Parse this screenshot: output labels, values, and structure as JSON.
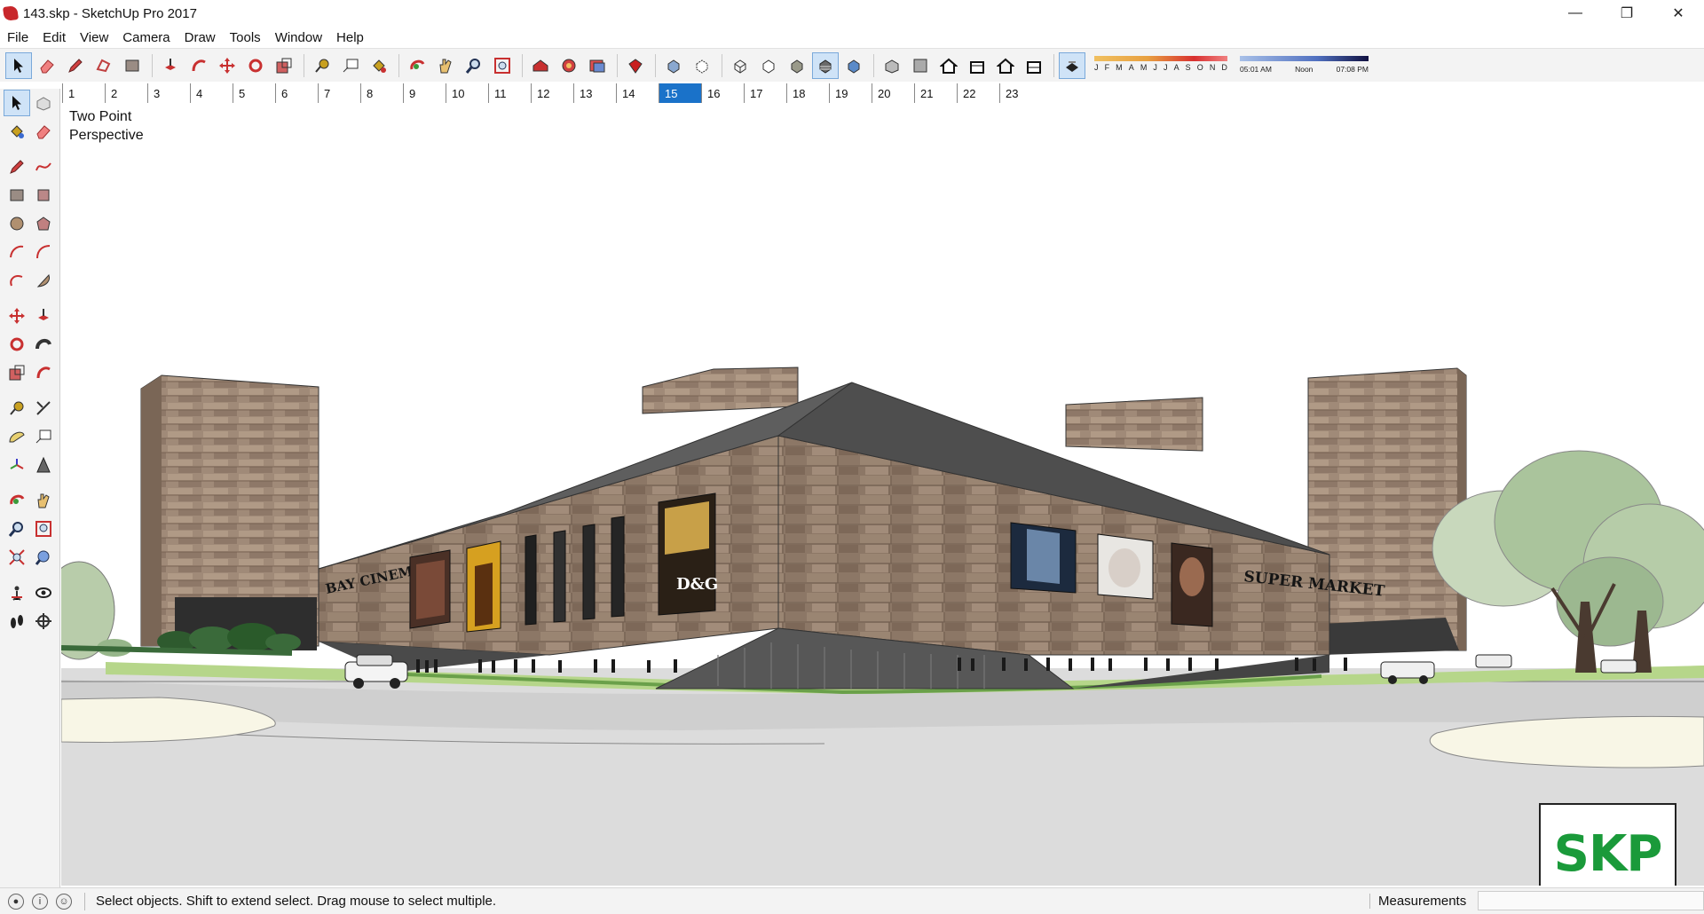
{
  "window": {
    "title": "143.skp - SketchUp Pro 2017",
    "minimize": "—",
    "maximize": "❐",
    "close": "✕"
  },
  "menu": [
    "File",
    "Edit",
    "View",
    "Camera",
    "Draw",
    "Tools",
    "Window",
    "Help"
  ],
  "scenes": {
    "tabs": [
      "1",
      "2",
      "3",
      "4",
      "5",
      "6",
      "7",
      "8",
      "9",
      "10",
      "11",
      "12",
      "13",
      "14",
      "15",
      "16",
      "17",
      "18",
      "19",
      "20",
      "21",
      "22",
      "23"
    ],
    "active": "15"
  },
  "shadow_settings": {
    "months": [
      "J",
      "F",
      "M",
      "A",
      "M",
      "J",
      "J",
      "A",
      "S",
      "O",
      "N",
      "D"
    ],
    "time_start": "05:01 AM",
    "time_mid": "Noon",
    "time_end": "07:08 PM"
  },
  "viewport": {
    "camera_label": "Two Point Perspective",
    "signs": {
      "left": "BAY CINEMA",
      "right": "SUPER MARKET",
      "poster": "D&G"
    },
    "logo": "SKP"
  },
  "status": {
    "hint": "Select objects. Shift to extend select. Drag mouse to select multiple.",
    "measurements_label": "Measurements",
    "measurements_value": ""
  },
  "colors": {
    "active_scene": "#1a72c9",
    "logo_green": "#1a9a3a",
    "app_icon": "#c8272b"
  },
  "icons": {
    "top_toolbar": [
      "select-arrow-icon",
      "eraser-icon",
      "pencil-icon",
      "polygon-lasso-icon",
      "rectangle-icon",
      "push-pull-icon",
      "offset-icon",
      "move-icon",
      "rotate-icon",
      "scale-icon",
      "tape-measure-icon",
      "text-label-icon",
      "paint-bucket-icon",
      "orbit-icon",
      "pan-icon",
      "zoom-icon",
      "zoom-extents-icon",
      "warehouse-icon",
      "extension-warehouse-icon",
      "layout-send-icon",
      "extension-manager-icon",
      "xray-icon",
      "back-edges-icon",
      "wireframe-icon",
      "hidden-line-icon",
      "shaded-icon",
      "shaded-textures-icon",
      "monochrome-icon",
      "iso-view-icon",
      "top-view-icon",
      "front-view-icon",
      "right-view-icon",
      "back-view-icon",
      "left-view-icon",
      "shadows-toggle-icon"
    ]
  }
}
